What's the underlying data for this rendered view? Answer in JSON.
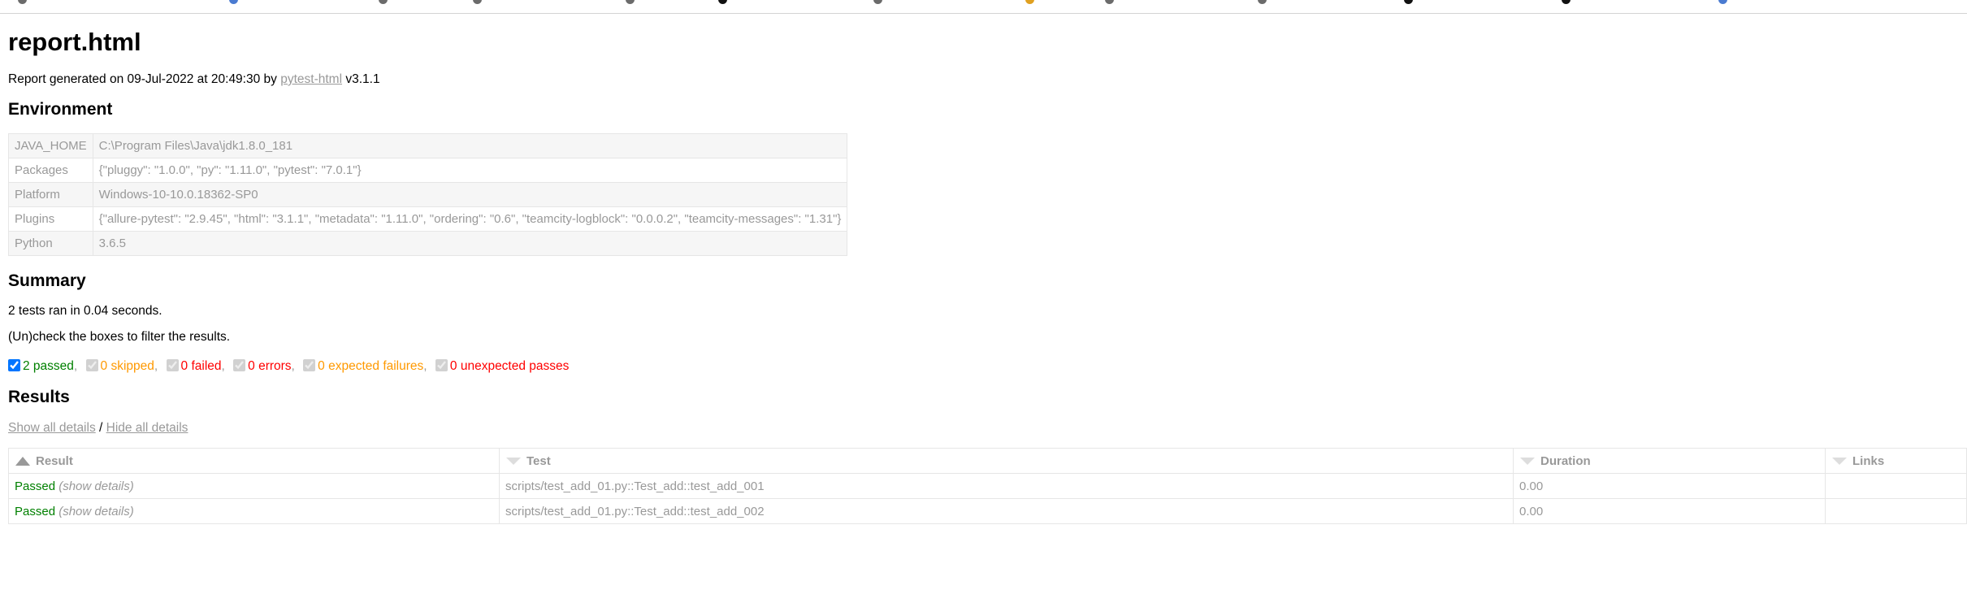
{
  "page": {
    "title": "report.html",
    "generated_prefix": "Report generated on 09-Jul-2022 at 20:49:30 by",
    "generator_link": "pytest-html",
    "generator_version": "v3.1.1"
  },
  "environment": {
    "heading": "Environment",
    "rows": [
      {
        "key": "JAVA_HOME",
        "value": "C:\\Program Files\\Java\\jdk1.8.0_181"
      },
      {
        "key": "Packages",
        "value": "{\"pluggy\": \"1.0.0\", \"py\": \"1.11.0\", \"pytest\": \"7.0.1\"}"
      },
      {
        "key": "Platform",
        "value": "Windows-10-10.0.18362-SP0"
      },
      {
        "key": "Plugins",
        "value": "{\"allure-pytest\": \"2.9.45\", \"html\": \"3.1.1\", \"metadata\": \"1.11.0\", \"ordering\": \"0.6\", \"teamcity-logblock\": \"0.0.0.2\", \"teamcity-messages\": \"1.31\"}"
      },
      {
        "key": "Python",
        "value": "3.6.5"
      }
    ]
  },
  "summary": {
    "heading": "Summary",
    "ran_text": "2 tests ran in 0.04 seconds.",
    "filter_hint": "(Un)check the boxes to filter the results.",
    "filters": [
      {
        "label": "2 passed",
        "checked": true,
        "enabled": true
      },
      {
        "label": "0 skipped",
        "checked": true,
        "enabled": false
      },
      {
        "label": "0 failed",
        "checked": true,
        "enabled": false
      },
      {
        "label": "0 errors",
        "checked": true,
        "enabled": false
      },
      {
        "label": "0 expected failures",
        "checked": true,
        "enabled": false
      },
      {
        "label": "0 unexpected passes",
        "checked": true,
        "enabled": false
      }
    ],
    "separator": ","
  },
  "results": {
    "heading": "Results",
    "show_all": "Show all details",
    "slash": " / ",
    "hide_all": "Hide all details",
    "columns": {
      "result": "Result",
      "test": "Test",
      "duration": "Duration",
      "links": "Links"
    },
    "rows": [
      {
        "outcome": "Passed",
        "details": "(show details)",
        "test": "scripts/test_add_01.py::Test_add::test_add_001",
        "duration": "0.00",
        "links": ""
      },
      {
        "outcome": "Passed",
        "details": "(show details)",
        "test": "scripts/test_add_01.py::Test_add::test_add_002",
        "duration": "0.00",
        "links": ""
      }
    ]
  },
  "colors": {
    "passed": "#008000",
    "skipped": "#ff9900",
    "failed": "#ff0000",
    "muted": "#999999"
  }
}
